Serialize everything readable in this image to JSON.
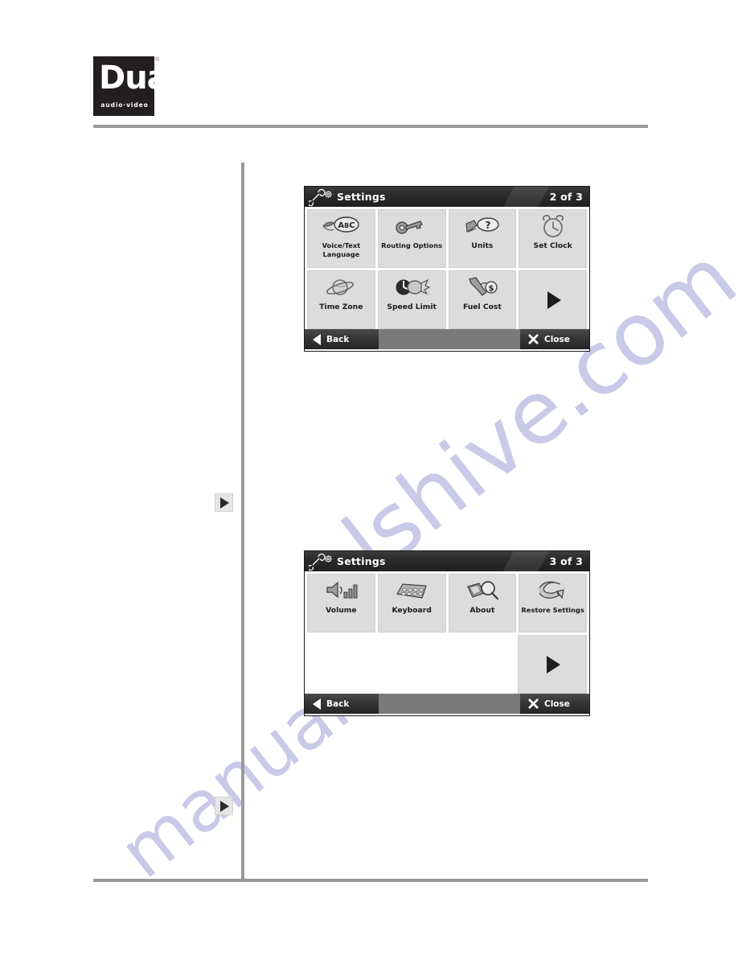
{
  "brand": {
    "logo_word": "Dual",
    "logo_tagline": "audio·video",
    "registered_mark": "®"
  },
  "watermark": {
    "line1": "lshive.com",
    "line2": "manualshive"
  },
  "margin_markers": [
    {
      "name": "next-page-marker-1",
      "icon": "play-triangle-icon"
    },
    {
      "name": "next-page-marker-2",
      "icon": "play-triangle-icon"
    }
  ],
  "screens": [
    {
      "id": "settings-page-2",
      "titlebar": {
        "icon": "wrench-gear-icon",
        "title": "Settings",
        "page_indicator": "2 of 3"
      },
      "rows": [
        [
          {
            "label": "Voice/Text\nLanguage",
            "icon": "lips-abc-icon",
            "type": "tile",
            "small": true
          },
          {
            "label": "Routing Options",
            "icon": "gear-key-icon",
            "type": "tile",
            "small": true
          },
          {
            "label": "Units",
            "icon": "ruler-question-icon",
            "type": "tile",
            "small": false
          },
          {
            "label": "Set Clock",
            "icon": "alarm-clock-icon",
            "type": "tile",
            "small": false
          }
        ],
        [
          {
            "label": "Time Zone",
            "icon": "planet-globe-icon",
            "type": "tile",
            "small": false
          },
          {
            "label": "Speed Limit",
            "icon": "speedometer-icon",
            "type": "tile",
            "small": false
          },
          {
            "label": "Fuel Cost",
            "icon": "fuel-nozzle-dollar-icon",
            "type": "tile",
            "small": false
          },
          {
            "label": "",
            "icon": "play-triangle-icon",
            "type": "nav",
            "small": false
          }
        ]
      ],
      "bottombar": {
        "back_label": "Back",
        "back_icon": "left-triangle-icon",
        "close_label": "Close",
        "close_icon": "x-close-icon"
      }
    },
    {
      "id": "settings-page-3",
      "titlebar": {
        "icon": "wrench-gear-icon",
        "title": "Settings",
        "page_indicator": "3 of 3"
      },
      "rows": [
        [
          {
            "label": "Volume",
            "icon": "speaker-bars-icon",
            "type": "tile",
            "small": false
          },
          {
            "label": "Keyboard",
            "icon": "keypad-icon",
            "type": "tile",
            "small": false
          },
          {
            "label": "About",
            "icon": "device-magnifier-icon",
            "type": "tile",
            "small": false
          },
          {
            "label": "Restore Settings",
            "icon": "restore-arrow-icon",
            "type": "tile",
            "small": true
          }
        ],
        [
          {
            "label": "",
            "icon": "",
            "type": "blank",
            "small": false
          },
          {
            "label": "",
            "icon": "",
            "type": "blank",
            "small": false
          },
          {
            "label": "",
            "icon": "",
            "type": "blank",
            "small": false
          },
          {
            "label": "",
            "icon": "play-triangle-icon",
            "type": "nav",
            "small": false
          }
        ]
      ],
      "bottombar": {
        "back_label": "Back",
        "back_icon": "left-triangle-icon",
        "close_label": "Close",
        "close_icon": "x-close-icon"
      }
    }
  ],
  "colors": {
    "rule": "#9a9a9a",
    "tile_bg": "#dcdcdc",
    "titlebar": "#2a2a2a",
    "bottombar": "#7a7a7a",
    "watermark": "#c9c9e8",
    "logo_bg": "#231f20"
  }
}
